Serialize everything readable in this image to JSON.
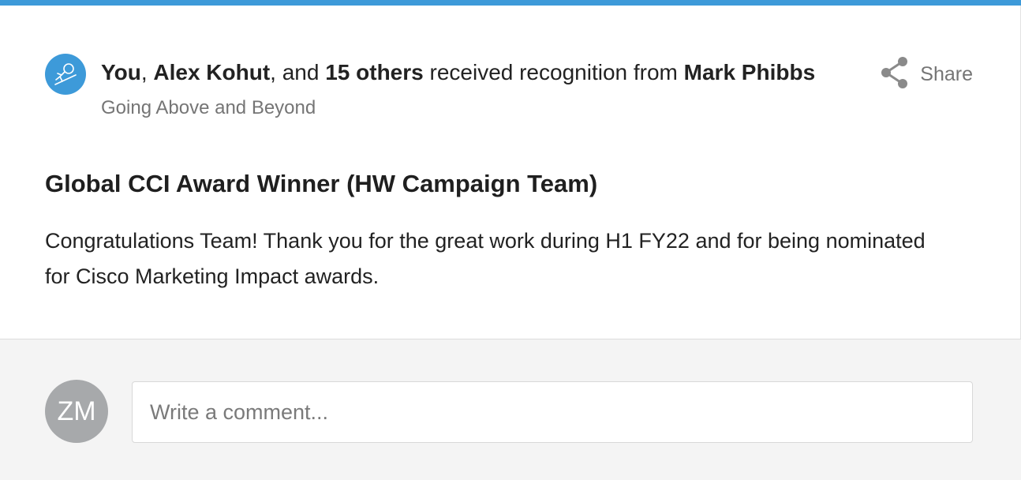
{
  "post": {
    "accent_color": "#3d9ad9",
    "icon": "recognition-icon",
    "recipients": {
      "you": "You",
      "sep1": ", ",
      "person": "Alex Kohut",
      "sep2": ", and ",
      "others": "15 others",
      "middle": " received recognition from ",
      "from": "Mark Phibbs"
    },
    "category": "Going Above and Beyond",
    "share_label": "Share",
    "share_icon": "share-icon",
    "title": "Global CCI Award Winner (HW Campaign Team)",
    "message": "Congratulations Team! Thank you for the great work during H1 FY22 and for being nominated for Cisco Marketing Impact awards."
  },
  "comment": {
    "avatar_initials": "ZM",
    "avatar_color": "#a7a9ab",
    "placeholder": "Write a comment..."
  }
}
